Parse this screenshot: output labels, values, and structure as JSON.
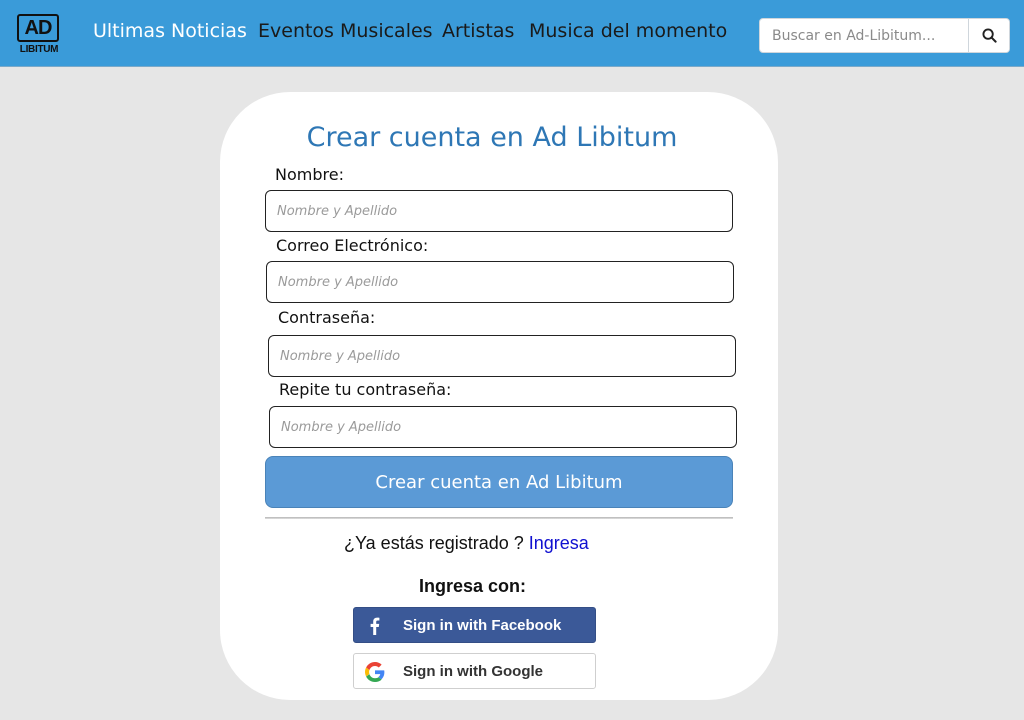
{
  "header": {
    "logo": {
      "top": "AD",
      "bottom": "LIBITUM"
    },
    "nav": [
      {
        "label": "Ultimas Noticias",
        "active": true
      },
      {
        "label": "Eventos Musicales",
        "active": false
      },
      {
        "label": "Artistas",
        "active": false
      },
      {
        "label": "Musica del momento",
        "active": false
      }
    ],
    "search": {
      "placeholder": "Buscar en Ad-Libitum...",
      "value": "",
      "icon": "search-icon"
    }
  },
  "form": {
    "title": "Crear cuenta en Ad Libitum",
    "fields": [
      {
        "label": "Nombre:",
        "placeholder": "Nombre y Apellido",
        "value": ""
      },
      {
        "label": "Correo Electrónico:",
        "placeholder": "Nombre y Apellido",
        "value": ""
      },
      {
        "label": "Contraseña:",
        "placeholder": "Nombre y Apellido",
        "value": ""
      },
      {
        "label": "Repite tu contraseña:",
        "placeholder": "Nombre y Apellido",
        "value": ""
      }
    ],
    "submit_label": "Crear cuenta en Ad Libitum",
    "already_text": "¿Ya estás registrado ?",
    "login_link": "Ingresa",
    "social_heading": "Ingresa con:",
    "social": {
      "facebook": {
        "label": "Sign in with Facebook",
        "icon": "facebook-icon"
      },
      "google": {
        "label": "Sign in with Google",
        "icon": "google-icon"
      }
    }
  },
  "colors": {
    "header_bg": "#3a9bd9",
    "page_bg": "#e6e6e6",
    "title": "#2e77b5",
    "submit_bg": "#5b9ad6",
    "facebook_bg": "#3b5998",
    "link": "#1010d0"
  }
}
